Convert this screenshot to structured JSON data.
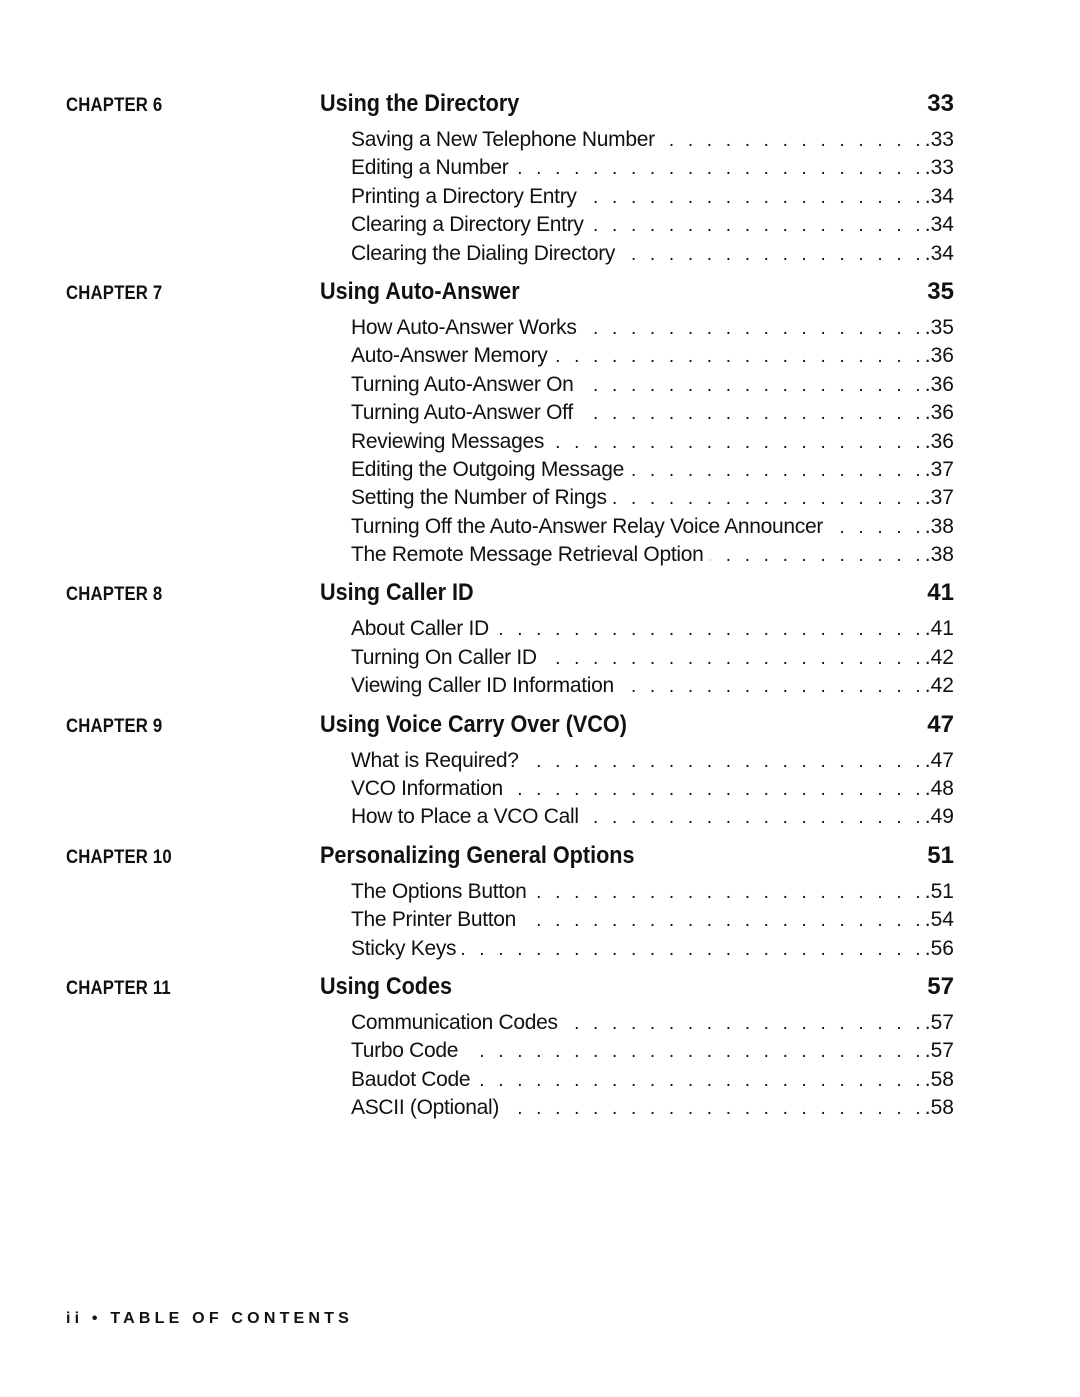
{
  "chapters": [
    {
      "label": "CHAPTER 6",
      "title": "Using the Directory",
      "page": "33",
      "entries": [
        {
          "title": "Saving a New Telephone Number",
          "page": ".33"
        },
        {
          "title": "Editing a Number",
          "page": ".33"
        },
        {
          "title": "Printing a Directory Entry",
          "page": ".34"
        },
        {
          "title": "Clearing a Directory Entry",
          "page": ".34"
        },
        {
          "title": "Clearing the Dialing Directory",
          "page": ".34"
        }
      ]
    },
    {
      "label": "CHAPTER 7",
      "title": "Using Auto-Answer",
      "page": "35",
      "entries": [
        {
          "title": "How Auto-Answer Works",
          "page": ".35"
        },
        {
          "title": "Auto-Answer Memory",
          "page": ".36"
        },
        {
          "title": "Turning Auto-Answer On",
          "page": ".36"
        },
        {
          "title": "Turning Auto-Answer Off",
          "page": ".36"
        },
        {
          "title": "Reviewing Messages",
          "page": ".36"
        },
        {
          "title": "Editing the Outgoing Message",
          "page": ".37"
        },
        {
          "title": "Setting the Number of Rings",
          "page": ".37"
        },
        {
          "title": "Turning Off the Auto-Answer Relay Voice Announcer",
          "page": ".38"
        },
        {
          "title": "The Remote Message Retrieval Option",
          "page": ".38"
        }
      ]
    },
    {
      "label": "CHAPTER 8",
      "title": "Using Caller ID",
      "page": "41",
      "entries": [
        {
          "title": "About Caller ID",
          "page": ".41"
        },
        {
          "title": "Turning On Caller ID",
          "page": ".42"
        },
        {
          "title": "Viewing Caller ID Information",
          "page": ".42"
        }
      ]
    },
    {
      "label": "CHAPTER 9",
      "title": "Using Voice Carry Over (VCO)",
      "page": "47",
      "entries": [
        {
          "title": "What is Required?",
          "page": ".47"
        },
        {
          "title": "VCO Information",
          "page": ".48"
        },
        {
          "title": "How to Place a VCO Call",
          "page": ".49"
        }
      ]
    },
    {
      "label": "CHAPTER 10",
      "title": "Personalizing General Options",
      "page": "51",
      "entries": [
        {
          "title": "The Options Button",
          "page": ".51"
        },
        {
          "title": "The Printer Button",
          "page": ".54"
        },
        {
          "title": "Sticky Keys",
          "page": ".56"
        }
      ]
    },
    {
      "label": "CHAPTER 11",
      "title": "Using Codes",
      "page": "57",
      "entries": [
        {
          "title": "Communication Codes",
          "page": ".57"
        },
        {
          "title": "Turbo Code",
          "page": ".57"
        },
        {
          "title": "Baudot Code",
          "page": ".58"
        },
        {
          "title": "ASCII (Optional)",
          "page": ".58"
        }
      ]
    }
  ],
  "footer": "ii • TABLE OF CONTENTS"
}
